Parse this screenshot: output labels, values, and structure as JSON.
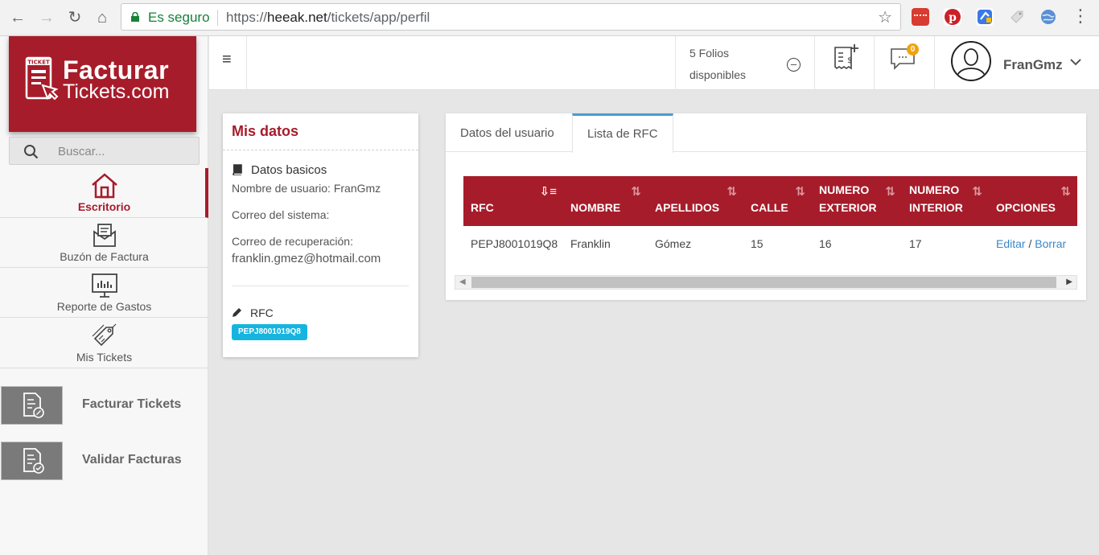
{
  "browser": {
    "secure_label": "Es seguro",
    "url_scheme": "https://",
    "url_host": "heeak.net",
    "url_path": "/tickets/app/perfil",
    "extension_icons": [
      "office-addin-icon",
      "pinterest-icon",
      "drive-sync-icon",
      "tag-extension-icon",
      "globe-extension-icon"
    ]
  },
  "brand": {
    "logo_line1": "Facturar",
    "logo_line2": "Tickets.com",
    "logo_ticket": "TICKET",
    "color": "#a71c2a"
  },
  "search": {
    "placeholder": "Buscar..."
  },
  "sidebar": {
    "items": [
      {
        "label": "Escritorio",
        "icon": "home-icon",
        "active": true
      },
      {
        "label": "Buzón de Factura",
        "icon": "mailbox-icon"
      },
      {
        "label": "Reporte de Gastos",
        "icon": "monitor-chart-icon"
      },
      {
        "label": "Mis Tickets",
        "icon": "tags-icon"
      }
    ],
    "actions": [
      {
        "label": "Facturar Tickets",
        "icon": "invoice-percent-icon"
      },
      {
        "label": "Validar Facturas",
        "icon": "invoice-check-icon"
      }
    ]
  },
  "header": {
    "folios_line1": "5 Folios",
    "folios_line2": "disponibles",
    "notifications_count": "0",
    "username": "FranGmz"
  },
  "profile": {
    "title": "Mis datos",
    "section_basic": "Datos basicos",
    "username_label": "Nombre de usuario: FranGmz",
    "system_email_label": "Correo del sistema:",
    "recovery_email_label": "Correo de recuperación:",
    "recovery_email": "franklin.gmez@hotmail.com",
    "rfc_heading": "RFC",
    "rfc_badge": "PEPJ8001019Q8"
  },
  "tabs": [
    {
      "label": "Datos del usuario",
      "active": false
    },
    {
      "label": "Lista de RFC",
      "active": true
    }
  ],
  "rfc_table": {
    "columns": [
      "RFC",
      "NOMBRE",
      "APELLIDOS",
      "CALLE",
      "NUMERO EXTERIOR",
      "NUMERO INTERIOR",
      "OPCIONES"
    ],
    "rows": [
      {
        "rfc": "PEPJ8001019Q8",
        "nombre": "Franklin",
        "apellidos": "Gómez",
        "calle": "15",
        "exterior": "16",
        "interior": "17",
        "edit": "Editar",
        "sep": "/",
        "delete": "Borrar"
      }
    ]
  }
}
